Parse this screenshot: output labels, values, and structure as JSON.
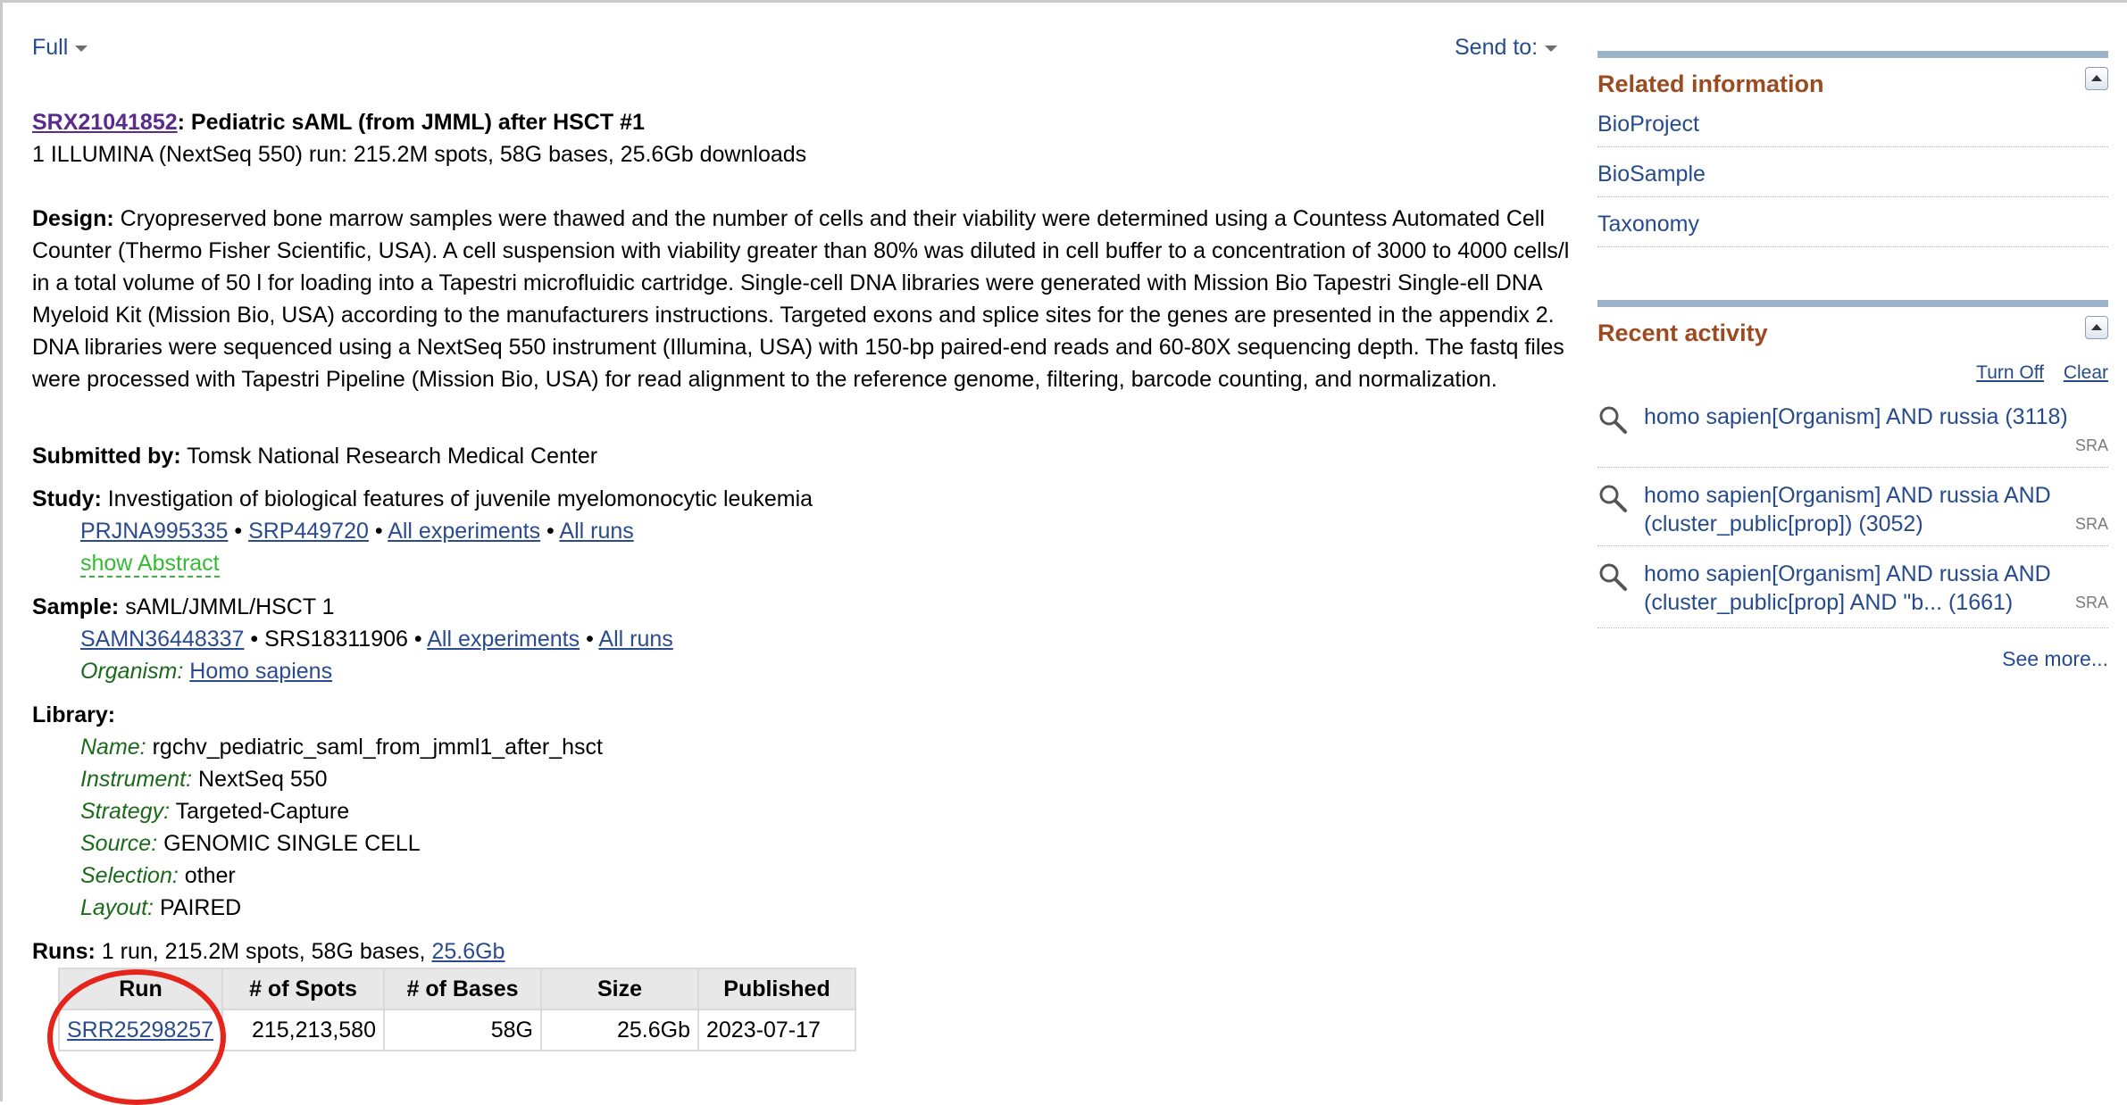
{
  "header": {
    "display_label": "Full",
    "send_to_label": "Send to:"
  },
  "record": {
    "accession": "SRX21041852",
    "title_rest": ": Pediatric sAML (from JMML) after HSCT #1",
    "summary": "1 ILLUMINA (NextSeq 550) run: 215.2M spots, 58G bases, 25.6Gb downloads"
  },
  "design": {
    "label": "Design:",
    "text": "Cryopreserved bone marrow samples were thawed and the number of cells and their viability were determined using a Countess Automated Cell Counter (Thermo Fisher Scientific, USA). A cell suspension with viability greater than 80% was diluted in cell buffer to a concentration of 3000 to 4000 cells/l in a total volume of 50 l for loading into a Tapestri microfluidic cartridge. Single-cell DNA libraries were generated with Mission Bio Tapestri Single-ell DNA Myeloid Kit (Mission Bio, USA) according to the manufacturers instructions. Targeted exons and splice sites for the genes are presented in the appendix 2. DNA libraries were sequenced using a NextSeq 550 instrument (Illumina, USA) with 150-bp paired-end reads and 60-80X sequencing depth. The fastq files were processed with Tapestri Pipeline (Mission Bio, USA) for read alignment to the reference genome, filtering, barcode counting, and normalization."
  },
  "submitted": {
    "label": "Submitted by:",
    "value": "Tomsk National Research Medical Center"
  },
  "study": {
    "label": "Study:",
    "value": "Investigation of biological features of juvenile myelomonocytic leukemia",
    "bioproject": "PRJNA995335",
    "srp": "SRP449720",
    "all_experiments": "All experiments",
    "all_runs": "All runs",
    "show_abstract": "show Abstract",
    "sep": "•"
  },
  "sample": {
    "label": "Sample:",
    "value": "sAML/JMML/HSCT 1",
    "biosample": "SAMN36448337",
    "srs": "SRS18311906",
    "all_experiments": "All experiments",
    "all_runs": "All runs",
    "organism_label": "Organism:",
    "organism": "Homo sapiens"
  },
  "library": {
    "label": "Library:",
    "fields": [
      {
        "label": "Name:",
        "value": "rgchv_pediatric_saml_from_jmml1_after_hsct"
      },
      {
        "label": "Instrument:",
        "value": "NextSeq 550"
      },
      {
        "label": "Strategy:",
        "value": "Targeted-Capture"
      },
      {
        "label": "Source:",
        "value": "GENOMIC SINGLE CELL"
      },
      {
        "label": "Selection:",
        "value": "other"
      },
      {
        "label": "Layout:",
        "value": "PAIRED"
      }
    ]
  },
  "runs": {
    "label": "Runs:",
    "summary": "1 run, 215.2M spots, 58G bases,",
    "size_link": "25.6Gb",
    "columns": [
      "Run",
      "# of Spots",
      "# of Bases",
      "Size",
      "Published"
    ],
    "rows": [
      {
        "run": "SRR25298257",
        "spots": "215,213,580",
        "bases": "58G",
        "size": "25.6Gb",
        "published": "2023-07-17"
      }
    ]
  },
  "sidebar": {
    "related": {
      "title": "Related information",
      "items": [
        "BioProject",
        "BioSample",
        "Taxonomy"
      ]
    },
    "recent": {
      "title": "Recent activity",
      "turn_off": "Turn Off",
      "clear": "Clear",
      "items": [
        {
          "line1": "homo sapien[Organism] AND russia (3118)",
          "line2": "",
          "db": "SRA"
        },
        {
          "line1": "homo sapien[Organism] AND russia AND",
          "line2": "(cluster_public[prop]) (3052)",
          "db": "SRA"
        },
        {
          "line1": "homo sapien[Organism] AND russia AND",
          "line2": "(cluster_public[prop] AND \"b... (1661)",
          "db": "SRA"
        }
      ],
      "see_more": "See more..."
    }
  },
  "colors": {
    "link": "#2a4b8d",
    "panel_title": "#9c4b20",
    "highlight_circle": "#e5241b",
    "green_label": "#1a6a1a"
  },
  "icons": {
    "search": "magnifier-icon",
    "collapse": "collapse-toggle-icon",
    "dropdown": "caret-down-icon"
  }
}
